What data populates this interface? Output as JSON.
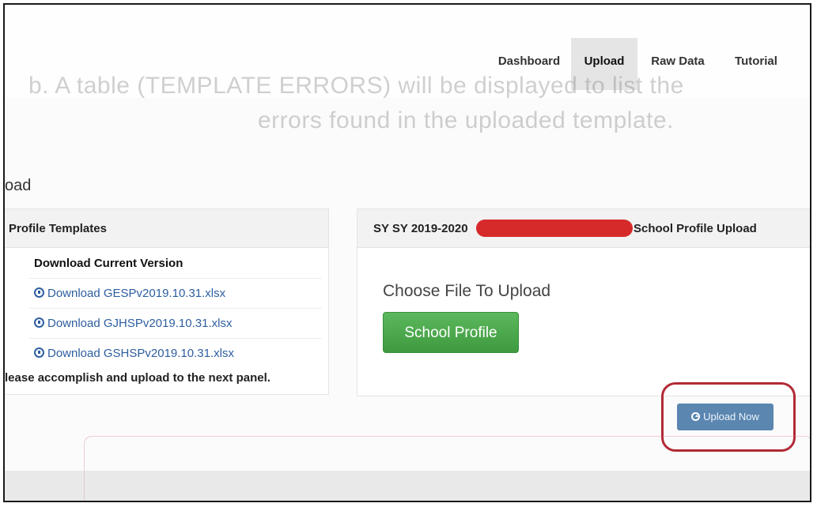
{
  "nav": {
    "items": [
      {
        "label": "Dashboard",
        "active": false
      },
      {
        "label": "Upload",
        "active": true
      },
      {
        "label": "Raw Data",
        "active": false
      },
      {
        "label": "Tutorial",
        "active": false
      }
    ]
  },
  "overlay": {
    "line1": "b. A table (TEMPLATE ERRORS) will be displayed to list the",
    "line2": "errors found in the uploaded template."
  },
  "page": {
    "breadcrumb": "oad"
  },
  "left_panel": {
    "title": "Profile Templates",
    "list_header": "Download Current Version",
    "downloads": [
      {
        "label": "Download GESPv2019.10.31.xlsx",
        "icon": "download-circle-icon"
      },
      {
        "label": "Download GJHSPv2019.10.31.xlsx",
        "icon": "download-circle-icon"
      },
      {
        "label": "Download GSHSPv2019.10.31.xlsx",
        "icon": "download-circle-icon"
      }
    ],
    "note": "lease accomplish and upload to the next panel."
  },
  "right_panel": {
    "title_prefix": "SY SY 2019-2020",
    "title_suffix": "School Profile Upload",
    "redaction_color": "#d62a2a",
    "choose_label": "Choose File To Upload",
    "file_button": "School Profile",
    "upload_button": "Upload Now",
    "upload_icon": "upload-circle-icon"
  },
  "colors": {
    "accent_green": "#4cae4c",
    "upload_blue": "#5a86b0",
    "highlight_red": "#b22a36",
    "link_blue": "#2d5ea0"
  }
}
